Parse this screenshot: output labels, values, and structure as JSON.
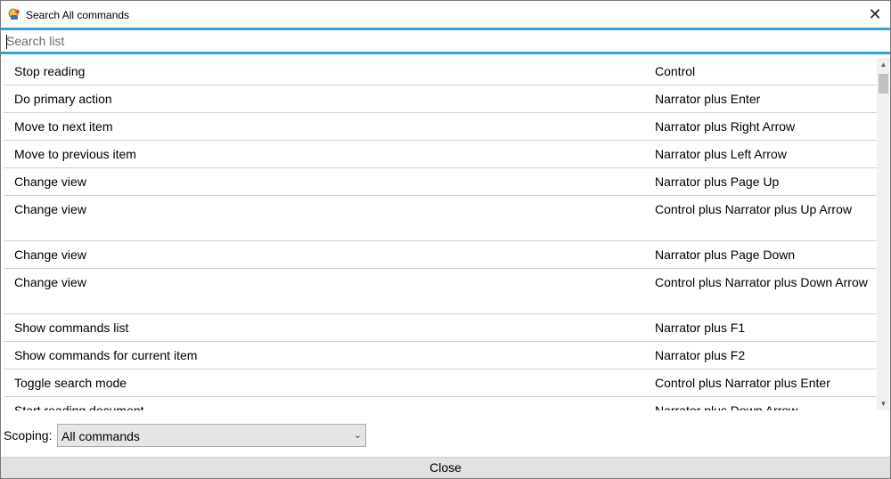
{
  "window": {
    "title": "Search All commands",
    "close_glyph": "✕",
    "icon": "narrator-app-icon"
  },
  "search": {
    "placeholder": "Search list",
    "value": ""
  },
  "commands": [
    {
      "command": "Stop reading",
      "keys": "Control"
    },
    {
      "command": "Do primary action",
      "keys": "Narrator plus Enter"
    },
    {
      "command": "Move to next item",
      "keys": "Narrator plus Right Arrow"
    },
    {
      "command": "Move to previous item",
      "keys": "Narrator plus Left Arrow"
    },
    {
      "command": "Change view",
      "keys": "Narrator plus Page Up"
    },
    {
      "command": "Change view",
      "keys": "Control plus Narrator plus Up Arrow"
    },
    {
      "command": "Change view",
      "keys": "Narrator plus Page Down"
    },
    {
      "command": "Change view",
      "keys": "Control plus Narrator plus Down Arrow"
    },
    {
      "command": "Show commands list",
      "keys": "Narrator plus F1"
    },
    {
      "command": "Show commands for current item",
      "keys": "Narrator plus F2"
    },
    {
      "command": "Toggle search mode",
      "keys": "Control plus Narrator plus Enter"
    },
    {
      "command": "Start reading document",
      "keys": "Narrator plus Down Arrow"
    }
  ],
  "scrollbar": {
    "up_glyph": "▲",
    "down_glyph": "▼"
  },
  "scoping": {
    "label": "Scoping:",
    "selected": "All commands",
    "chevron": "⌄"
  },
  "footer": {
    "close_label": "Close"
  },
  "colors": {
    "accent": "#2ea3dd",
    "row_divider": "#d2d2d2",
    "button_bg": "#e1e1e1"
  }
}
